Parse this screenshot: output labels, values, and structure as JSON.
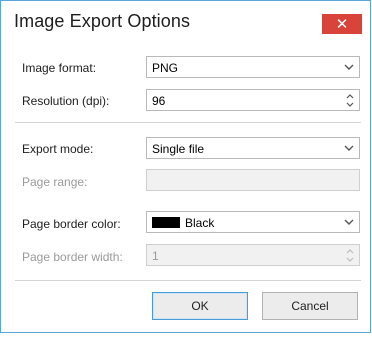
{
  "window": {
    "title": "Image Export Options",
    "close_glyph": "✕"
  },
  "form": {
    "image_format": {
      "label": "Image format:",
      "value": "PNG"
    },
    "resolution": {
      "label": "Resolution (dpi):",
      "value": "96"
    },
    "export_mode": {
      "label": "Export mode:",
      "value": "Single file"
    },
    "page_range": {
      "label": "Page range:",
      "value": ""
    },
    "page_border_color": {
      "label": "Page border color:",
      "value": "Black",
      "swatch": "#000000"
    },
    "page_border_width": {
      "label": "Page border width:",
      "value": "1"
    }
  },
  "buttons": {
    "ok": "OK",
    "cancel": "Cancel"
  },
  "colors": {
    "close_button": "#d9443a",
    "window_border": "#5aa5d8",
    "default_button_border": "#4a9bd6"
  }
}
